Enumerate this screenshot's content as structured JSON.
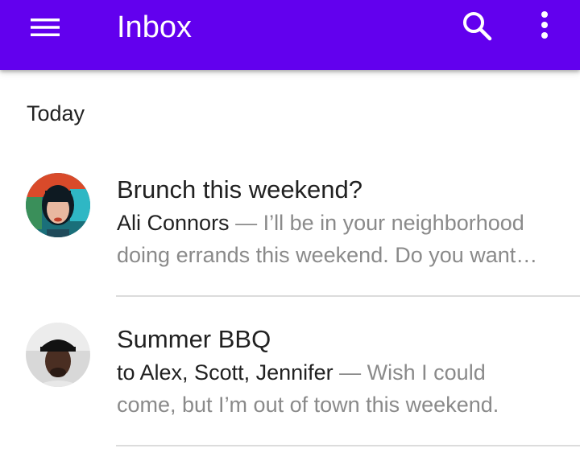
{
  "app_bar": {
    "title": "Inbox",
    "background": "#6200ee",
    "icons": [
      "menu-icon",
      "search-icon",
      "more-vert-icon"
    ]
  },
  "list": {
    "subheader": "Today",
    "items": [
      {
        "subject": "Brunch this weekend?",
        "sender": "Ali Connors",
        "preview_line1": " — I’ll be in your neighborhood",
        "preview_line2": "doing errands this weekend. Do you want…"
      },
      {
        "subject": "Summer BBQ",
        "sender": "to Alex, Scott, Jennifer",
        "preview_line1": " — Wish I could",
        "preview_line2": "come, but I’m out of town this weekend."
      }
    ]
  }
}
